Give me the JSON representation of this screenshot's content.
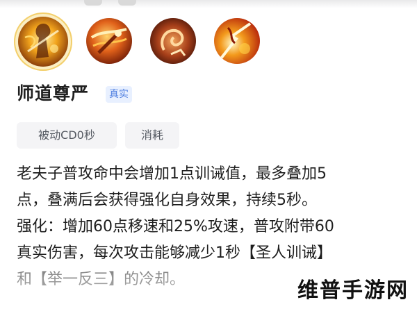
{
  "skills": {
    "selected_index": 0,
    "icons": [
      {
        "name": "skill-1-icon",
        "accent": "#e8a21a"
      },
      {
        "name": "skill-2-icon",
        "accent": "#d9641c"
      },
      {
        "name": "skill-3-icon",
        "accent": "#b5481e"
      },
      {
        "name": "skill-4-icon",
        "accent": "#e37a1f"
      }
    ]
  },
  "skill_detail": {
    "name": "师道尊严",
    "tag": "真实",
    "tag_color": "#4f7fe0",
    "chips": {
      "cooldown": "被动CD0秒",
      "cost": "消耗"
    },
    "description_lines": [
      "老夫子普攻命中会增加1点训诫值，最多叠加5",
      "点，叠满后会获得强化自身效果，持续5秒。",
      "强化：增加60点移速和25%攻速，普攻附带60",
      "真实伤害，每次攻击能够减少1秒【圣人训诫】",
      "和【举一反三】的冷却。"
    ]
  },
  "watermark": "维普手游网"
}
